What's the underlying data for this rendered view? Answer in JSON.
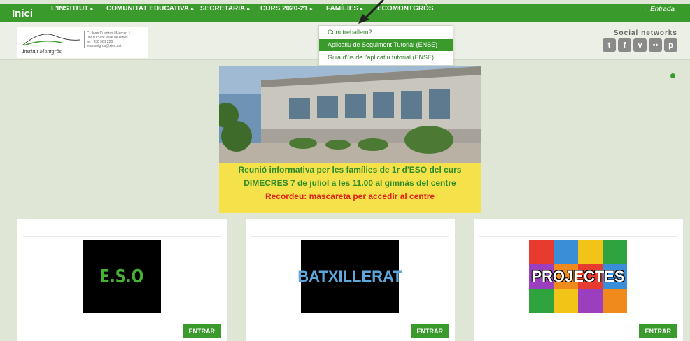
{
  "nav": {
    "brand": "Inici",
    "items": [
      {
        "label": "L'INSTITUT",
        "arrow": "▸"
      },
      {
        "label": "COMUNITAT EDUCATIVA",
        "arrow": "▸"
      },
      {
        "label": "SECRETARIA",
        "arrow": "▸"
      },
      {
        "label": "CURS 2020-21",
        "arrow": "▸"
      },
      {
        "label": "FAMÍLIES",
        "arrow": "▸"
      },
      {
        "label": "ECOMONTGRÒS",
        "arrow": ""
      }
    ],
    "login_icon": "→",
    "login_label": "Entrada"
  },
  "header": {
    "logo_name": "Institut Montgròs",
    "logo_info": [
      "C/ Joan Cuadras i Mércer, 1",
      "08810 Sant Pere de Ribes",
      "tel.: 938 961 220",
      "iesmontgros@xtec.cat"
    ],
    "social_title": "Social networks",
    "social_icons": [
      "t",
      "f",
      "v",
      "••",
      "p"
    ]
  },
  "dropdown": {
    "items": [
      {
        "label": "Com treballem?"
      },
      {
        "label": "Aplicatiu de Seguiment Tutorial (ENSE)"
      },
      {
        "label": "Guia d'ús de l'aplicatiu tutorial (ENSE)"
      }
    ]
  },
  "banner": {
    "line1": "Reunió informativa per les famílies de 1r d'ESO del curs",
    "line2": "DIMECRES 7 de juliol a les 11.00 al gimnàs del centre",
    "line3": "Recordeu: mascareta per accedir al centre"
  },
  "cards": [
    {
      "image_text": "E.S.O",
      "button": "ENTRAR"
    },
    {
      "image_text": "BATXILLERAT",
      "button": "ENTRAR"
    },
    {
      "image_text": "PROJECTES",
      "button": "ENTRAR"
    }
  ]
}
